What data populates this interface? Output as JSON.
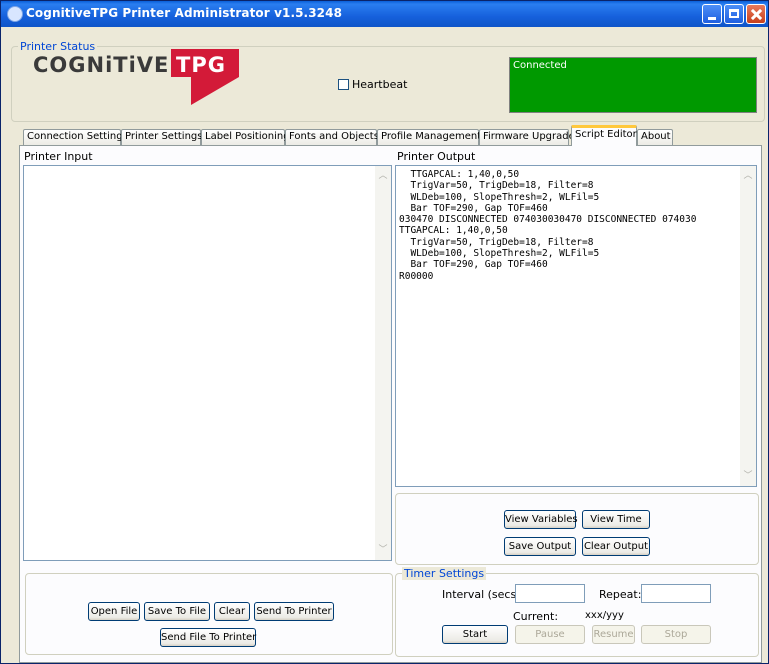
{
  "window": {
    "title": "CognitiveTPG Printer Administrator v1.5.3248"
  },
  "printer_status": {
    "group_label": "Printer Status",
    "logo_text_1": "COGNiTiVE",
    "logo_text_2": "TPG",
    "heartbeat_label": "Heartbeat",
    "heartbeat_checked": false,
    "connection_status": "Connected",
    "status_color": "#009900"
  },
  "tabs": [
    {
      "label": "Connection Settings"
    },
    {
      "label": "Printer Settings"
    },
    {
      "label": "Label Positioning"
    },
    {
      "label": "Fonts and Objects"
    },
    {
      "label": "Profile Management"
    },
    {
      "label": "Firmware Upgrade"
    },
    {
      "label": "Script Editor",
      "active": true
    },
    {
      "label": "About"
    }
  ],
  "script_editor": {
    "input_label": "Printer Input",
    "input_value": "",
    "output_label": "Printer Output",
    "output_text": "  TTGAPCAL: 1,40,0,50\n  TrigVar=50, TrigDeb=18, Filter=8\n  WLDeb=100, SlopeThresh=2, WLFil=5\n  Bar TOF=290, Gap TOF=460\n030470 DISCONNECTED 074030030470 DISCONNECTED 074030\nTTGAPCAL: 1,40,0,50\n  TrigVar=50, TrigDeb=18, Filter=8\n  WLDeb=100, SlopeThresh=2, WLFil=5\n  Bar TOF=290, Gap TOF=460\nR00000",
    "buttons": {
      "open_file": "Open File",
      "save_to_file": "Save To File",
      "clear": "Clear",
      "send_to_printer": "Send To Printer",
      "send_file_to_printer": "Send File To Printer",
      "view_variables": "View Variables",
      "view_time": "View Time",
      "save_output": "Save Output",
      "clear_output": "Clear Output"
    }
  },
  "timer_settings": {
    "group_label": "Timer Settings",
    "interval_label": "Interval (secs):",
    "interval_value": "",
    "repeat_label": "Repeat:",
    "repeat_value": "",
    "current_label": "Current:",
    "current_value": "xxx/yyy",
    "start": "Start",
    "pause": "Pause",
    "resume": "Resume",
    "stop": "Stop"
  }
}
